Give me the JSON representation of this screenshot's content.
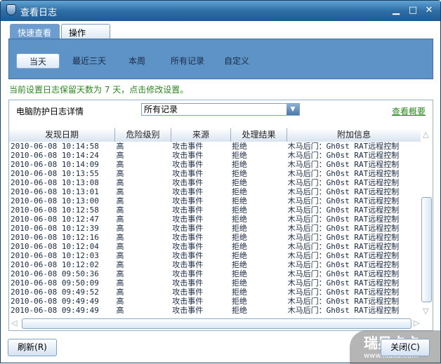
{
  "window": {
    "title": "查看日志",
    "min": "▁",
    "max": "□",
    "close": "✕"
  },
  "tabs": [
    {
      "label": "快速查看"
    },
    {
      "label": "操作"
    }
  ],
  "filters": [
    "当天",
    "最近三天",
    "本周",
    "所有记录",
    "自定义"
  ],
  "notice": "当前设置日志保留天数为 7 天，点击修改设置。",
  "details": {
    "label": "电脑防护日志详情",
    "select_value": "所有记录",
    "overview_link": "查看概要"
  },
  "columns": [
    "发现日期",
    "危险级别",
    "来源",
    "处理结果",
    "附加信息"
  ],
  "rows": [
    [
      "2010-06-08 10:14:58",
      "高",
      "攻击事件",
      "拒绝",
      "木马后门：Gh0st RAT远程控制"
    ],
    [
      "2010-06-08 10:14:24",
      "高",
      "攻击事件",
      "拒绝",
      "木马后门：Gh0st RAT远程控制"
    ],
    [
      "2010-06-08 10:14:09",
      "高",
      "攻击事件",
      "拒绝",
      "木马后门：Gh0st RAT远程控制"
    ],
    [
      "2010-06-08 10:13:55",
      "高",
      "攻击事件",
      "拒绝",
      "木马后门：Gh0st RAT远程控制"
    ],
    [
      "2010-06-08 10:13:08",
      "高",
      "攻击事件",
      "拒绝",
      "木马后门：Gh0st RAT远程控制"
    ],
    [
      "2010-06-08 10:13:01",
      "高",
      "攻击事件",
      "拒绝",
      "木马后门：Gh0st RAT远程控制"
    ],
    [
      "2010-06-08 10:13:00",
      "高",
      "攻击事件",
      "拒绝",
      "木马后门：Gh0st RAT远程控制"
    ],
    [
      "2010-06-08 10:12:58",
      "高",
      "攻击事件",
      "拒绝",
      "木马后门：Gh0st RAT远程控制"
    ],
    [
      "2010-06-08 10:12:47",
      "高",
      "攻击事件",
      "拒绝",
      "木马后门：Gh0st RAT远程控制"
    ],
    [
      "2010-06-08 10:12:39",
      "高",
      "攻击事件",
      "拒绝",
      "木马后门：Gh0st RAT远程控制"
    ],
    [
      "2010-06-08 10:12:16",
      "高",
      "攻击事件",
      "拒绝",
      "木马后门：Gh0st RAT远程控制"
    ],
    [
      "2010-06-08 10:12:04",
      "高",
      "攻击事件",
      "拒绝",
      "木马后门：Gh0st RAT远程控制"
    ],
    [
      "2010-06-08 10:12:03",
      "高",
      "攻击事件",
      "拒绝",
      "木马后门：Gh0st RAT远程控制"
    ],
    [
      "2010-06-08 10:12:02",
      "高",
      "攻击事件",
      "拒绝",
      "木马后门：Gh0st RAT远程控制"
    ],
    [
      "2010-06-08 09:50:36",
      "高",
      "攻击事件",
      "拒绝",
      "木马后门：Gh0st RAT远程控制"
    ],
    [
      "2010-06-08 09:50:09",
      "高",
      "攻击事件",
      "拒绝",
      "木马后门：Gh0st RAT远程控制"
    ],
    [
      "2010-06-08 09:49:52",
      "高",
      "攻击事件",
      "拒绝",
      "木马后门：Gh0st RAT远程控制"
    ],
    [
      "2010-06-08 09:49:49",
      "高",
      "攻击事件",
      "拒绝",
      "木马后门：Gh0st RAT远程控制"
    ],
    [
      "2010-06-08 09:49:49",
      "高",
      "攻击事件",
      "拒绝",
      "木马后门：Gh0st RAT远程控制"
    ]
  ],
  "buttons": {
    "refresh": "刷新(R)",
    "close": "关闭(C)"
  },
  "watermark": {
    "name": "瑞星卡卡",
    "url": "www.ikaka.com"
  }
}
